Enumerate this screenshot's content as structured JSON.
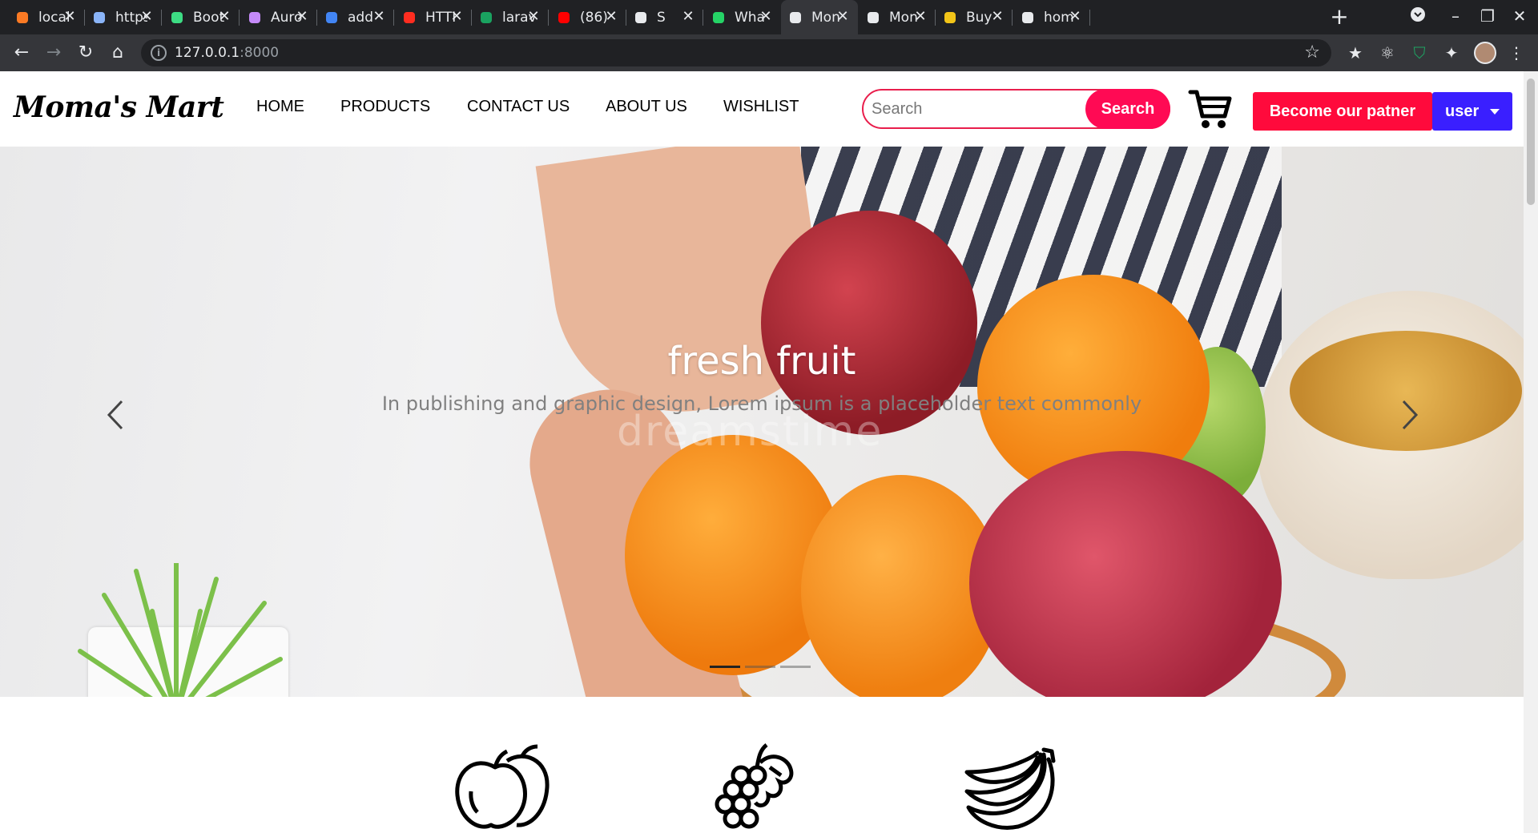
{
  "browser": {
    "tabs": [
      {
        "title": "locall",
        "icon": "xampp-icon"
      },
      {
        "title": "https",
        "icon": "compass-icon"
      },
      {
        "title": "Boot",
        "icon": "w-icon"
      },
      {
        "title": "Auro",
        "icon": "aurora-icon"
      },
      {
        "title": "add",
        "icon": "google-icon"
      },
      {
        "title": "HTTI",
        "icon": "laravel-icon"
      },
      {
        "title": "larav",
        "icon": "star-icon"
      },
      {
        "title": "(86)",
        "icon": "youtube-icon"
      },
      {
        "title": "S",
        "icon": "globe-icon"
      },
      {
        "title": "Wha",
        "icon": "whatsapp-icon"
      },
      {
        "title": "Mon",
        "icon": "mart-icon"
      },
      {
        "title": "Mon",
        "icon": "mart-icon"
      },
      {
        "title": "Buy",
        "icon": "buy-icon"
      },
      {
        "title": "hom",
        "icon": "globe-icon"
      }
    ],
    "url": "127.0.0.1",
    "url_port": ":8000"
  },
  "header": {
    "logo": "Moma's Mart",
    "nav": [
      "HOME",
      "PRODUCTS",
      "CONTACT US",
      "ABOUT US",
      "WISHLIST"
    ],
    "search_placeholder": "Search",
    "search_button": "Search",
    "partner_button": "Become our patner",
    "user_button": "user"
  },
  "hero": {
    "title": "fresh fruit",
    "text": "In publishing and graphic design, Lorem ipsum is a placeholder text commonly",
    "watermark": "dreamstime",
    "slides": 3,
    "active_slide": 1
  },
  "categories": [
    "apple-icon",
    "grapes-icon",
    "banana-icon"
  ],
  "colors": {
    "accent": "#ff0a54",
    "partner": "#ff0a3c",
    "user": "#3a1fff"
  }
}
